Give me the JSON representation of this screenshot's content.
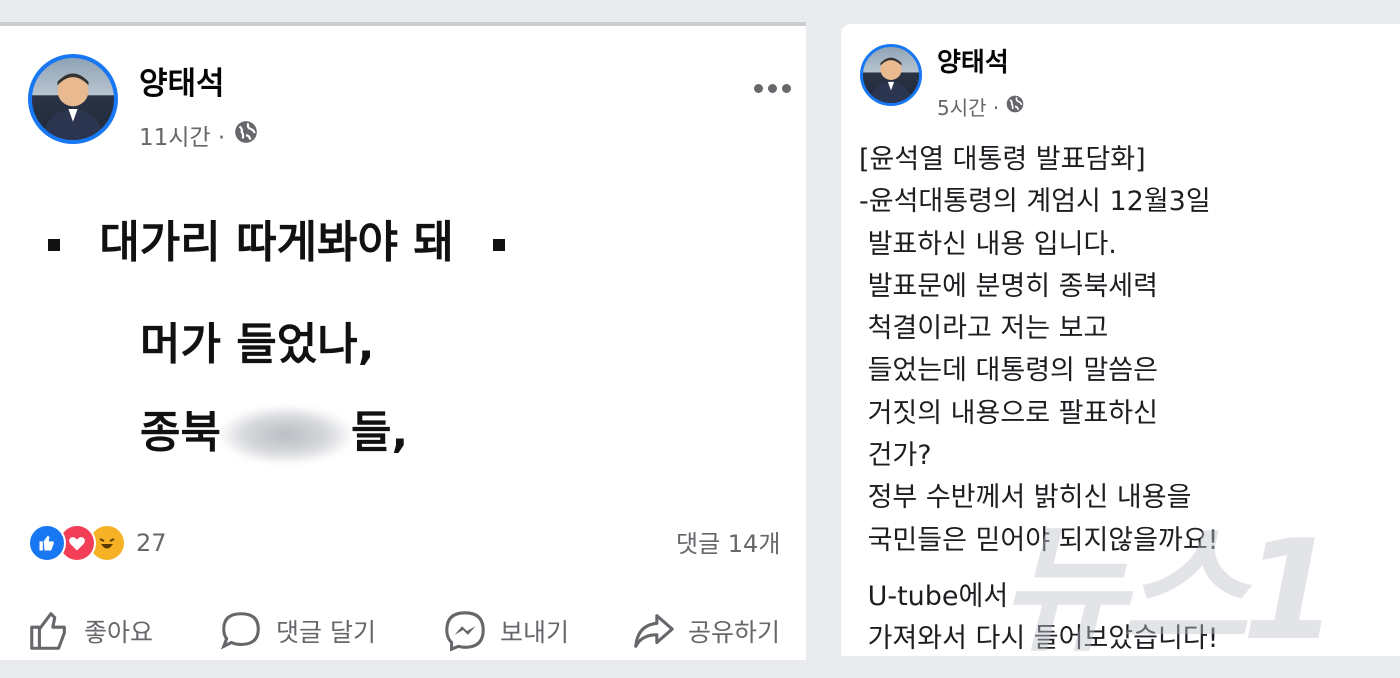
{
  "left_post": {
    "author": "양태석",
    "time": "11시간 ·",
    "more_icon": "ellipsis-icon",
    "big_text": {
      "line1": "대가리 따게봐야 돼",
      "line2": "머가 들었나,",
      "line3_part1": "종북",
      "line3_blurred": "세력",
      "line3_part2": "들,"
    },
    "reactions": {
      "icons": [
        "like-reaction-icon",
        "love-reaction-icon",
        "haha-reaction-icon"
      ],
      "count": "27"
    },
    "comments": "댓글 14개",
    "actions": {
      "like": "좋아요",
      "comment": "댓글 달기",
      "send": "보내기",
      "share": "공유하기"
    },
    "colors": {
      "brand": "#1877f2",
      "love": "#f33e58",
      "haha": "#f7b125"
    }
  },
  "right_post": {
    "author": "양태석",
    "time": "5시간 ·",
    "lines": [
      "[윤석열 대통령 발표담화]",
      "-윤석대통령의 계엄시 12월3일",
      " 발표하신 내용 입니다.",
      " 발표문에 분명히 종북세력",
      " 척결이라고 저는 보고",
      " 들었는데 대통령의 말씀은",
      " 거짓의 내용으로 팔표하신",
      " 건가?",
      " 정부 수반께서 밝히신 내용을",
      " 국민들은 믿어야 되지않을까요!",
      "",
      " U-tube에서",
      " 가져와서 다시 들어보았습니다!"
    ]
  },
  "watermark": "뉴스1"
}
